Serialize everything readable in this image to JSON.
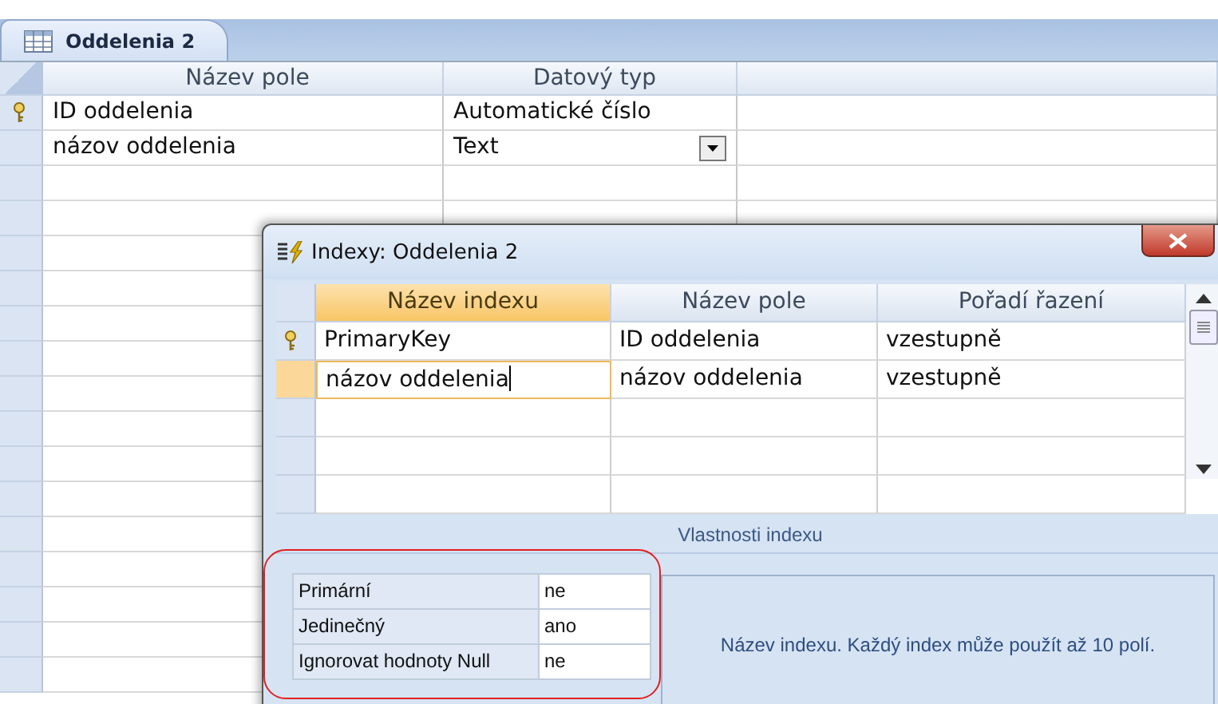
{
  "tab": {
    "label": "Oddelenia 2",
    "selected": true
  },
  "fields_table": {
    "columns": [
      "Název pole",
      "Datový typ"
    ],
    "rows": [
      {
        "name": "ID oddelenia",
        "type": "Automatické číslo",
        "primary_key": true,
        "selected": false
      },
      {
        "name": "názov oddelenia",
        "type": "Text",
        "primary_key": false,
        "selected": true
      }
    ]
  },
  "dialog": {
    "title": "Indexy: Oddelenia 2",
    "columns": [
      {
        "label": "Název indexu",
        "selected": true
      },
      {
        "label": "Název pole",
        "selected": false
      },
      {
        "label": "Pořadí řazení",
        "selected": false
      }
    ],
    "rows": [
      {
        "index_name": "PrimaryKey",
        "field": "ID oddelenia",
        "order": "vzestupně",
        "primary_key": true,
        "selected": false
      },
      {
        "index_name": "názov oddelenia",
        "field": "názov oddelenia",
        "order": "vzestupně",
        "primary_key": false,
        "selected": true
      }
    ],
    "properties_title": "Vlastnosti indexu",
    "properties": [
      {
        "label": "Primární",
        "value": "ne"
      },
      {
        "label": "Jedinečný",
        "value": "ano"
      },
      {
        "label": "Ignorovat hodnoty Null",
        "value": "ne"
      }
    ],
    "help": "Název indexu. Každý index může použít až 10 polí."
  }
}
